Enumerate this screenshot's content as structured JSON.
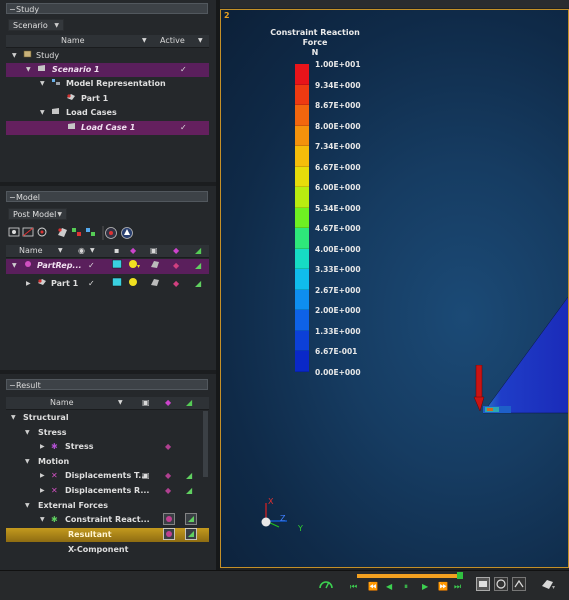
{
  "study": {
    "header": "Study",
    "dropdown": "Scenario",
    "col_name": "Name",
    "col_active": "Active",
    "rows": [
      {
        "label": "Study",
        "check": ""
      },
      {
        "label": "Scenario 1",
        "check": "✓"
      },
      {
        "label": "Model Representation",
        "check": ""
      },
      {
        "label": "Part 1",
        "check": ""
      },
      {
        "label": "Load Cases",
        "check": ""
      },
      {
        "label": "Load Case 1",
        "check": "✓"
      }
    ]
  },
  "model": {
    "header": "Model",
    "dropdown": "Post Model",
    "col_name": "Name",
    "rows": [
      {
        "label": "PartRep...",
        "check": "✓"
      },
      {
        "label": "Part 1",
        "check": "✓"
      }
    ]
  },
  "result": {
    "header": "Result",
    "col_name": "Name",
    "rows": [
      {
        "label": "Structural"
      },
      {
        "label": "Stress"
      },
      {
        "label": "Stress"
      },
      {
        "label": "Motion"
      },
      {
        "label": "Displacements T..."
      },
      {
        "label": "Displacements R..."
      },
      {
        "label": "External Forces"
      },
      {
        "label": "Constraint React..."
      },
      {
        "label": "Resultant"
      },
      {
        "label": "X-Component"
      }
    ]
  },
  "viewport": {
    "number": "2",
    "legend_title": "Constraint Reaction Force",
    "legend_unit": "N",
    "ticks": [
      "1.00E+001",
      "9.34E+000",
      "8.67E+000",
      "8.00E+000",
      "7.34E+000",
      "6.67E+000",
      "6.00E+000",
      "5.34E+000",
      "4.67E+000",
      "4.00E+000",
      "3.33E+000",
      "2.67E+000",
      "2.00E+000",
      "1.33E+000",
      "6.67E-001",
      "0.00E+000"
    ],
    "colors": [
      "#e8141a",
      "#ee3a12",
      "#f2660e",
      "#f4920c",
      "#f5bd0a",
      "#e6dc0a",
      "#b8ec10",
      "#6ef022",
      "#2ee87a",
      "#16dcc4",
      "#10bcec",
      "#0e8ef0",
      "#0e62e8",
      "#0c40d8",
      "#0a28c8",
      "#0a1cb8"
    ],
    "axis_x": "X",
    "axis_y": "Y",
    "axis_z": "Z"
  },
  "accent": "#c49028"
}
